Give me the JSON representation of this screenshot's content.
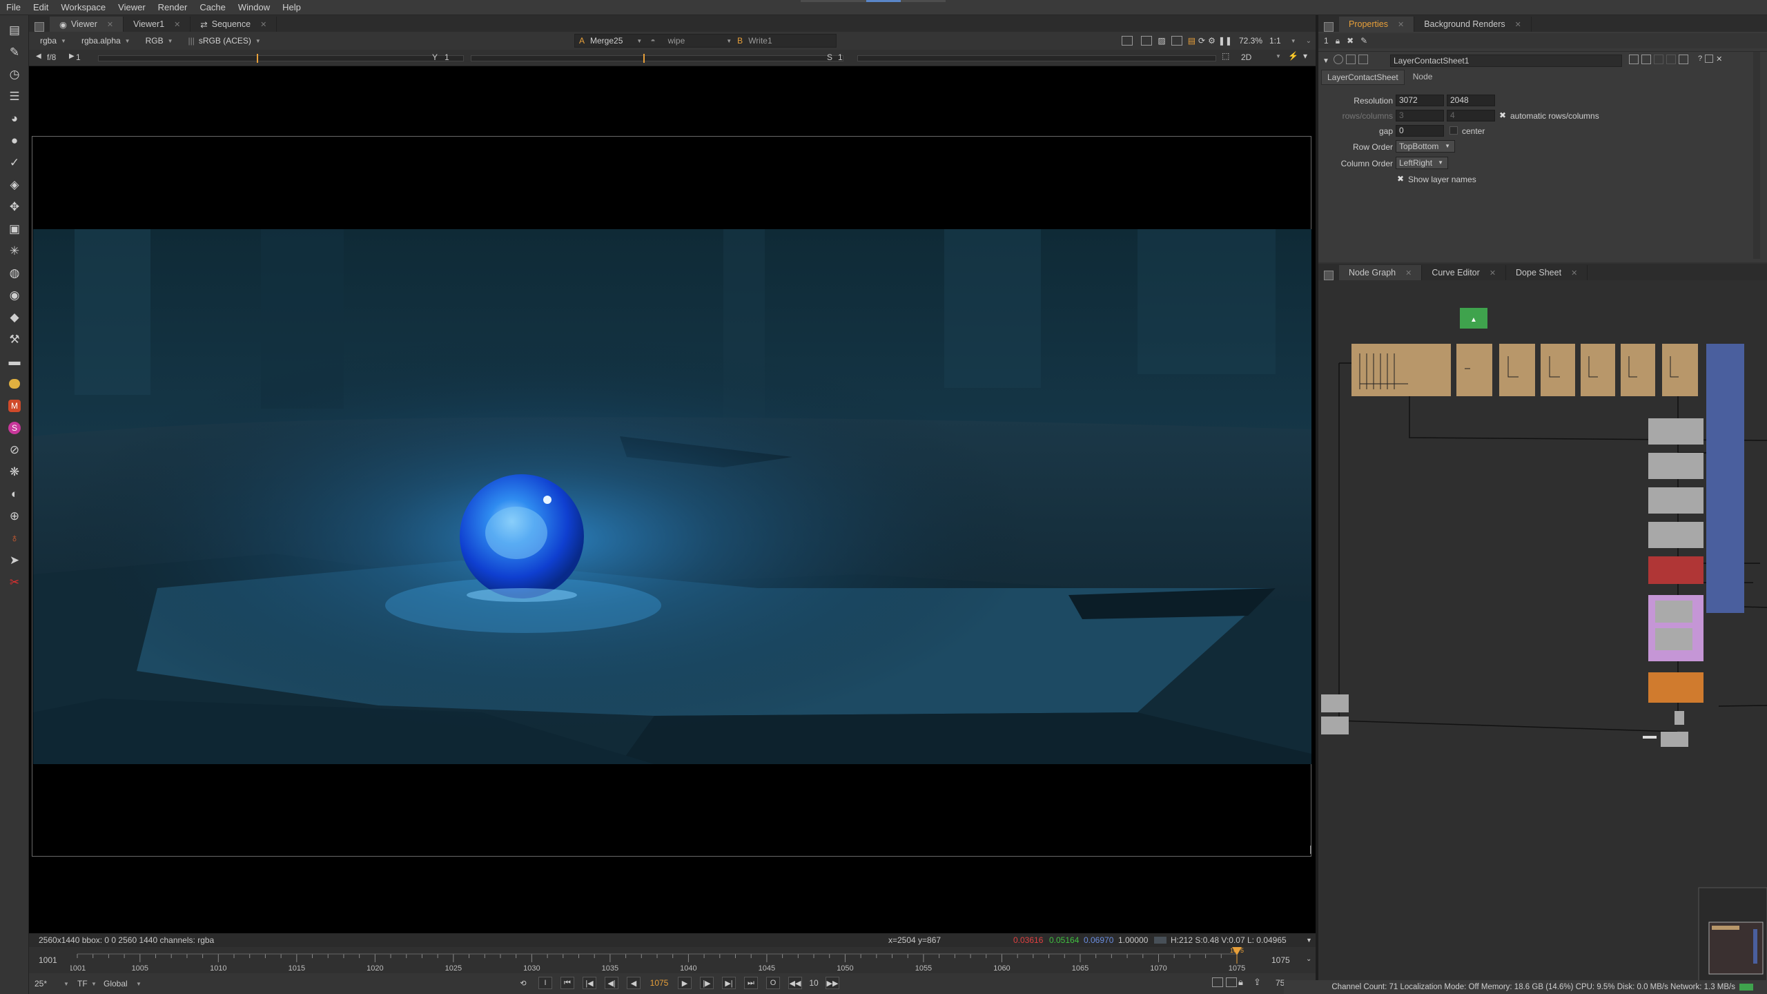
{
  "menu": [
    "File",
    "Edit",
    "Workspace",
    "Viewer",
    "Render",
    "Cache",
    "Window",
    "Help"
  ],
  "viewer_tabs": [
    {
      "label": "Viewer"
    },
    {
      "label": "Viewer1"
    },
    {
      "label": "Sequence"
    }
  ],
  "viewer_controls": {
    "layer": "rgba",
    "channel": "rgba.alpha",
    "colorspace": "RGB",
    "display": "sRGB (ACES)",
    "input_a_label": "A",
    "input_a": "Merge25",
    "wipe": "wipe",
    "input_b_label": "B",
    "input_b": "Write1",
    "zoom": "72.3%",
    "ratio": "1:1"
  },
  "viewer_controls2": {
    "fstop": "f/8",
    "fstop_value": "1",
    "y_label": "Y",
    "y_value": "1",
    "s_label": "S",
    "s_value": "1",
    "view_mode": "2D"
  },
  "info": {
    "format": "2560x1440  bbox: 0 0 2560 1440 channels: rgba",
    "coords": "x=2504 y=867",
    "r": "0.03616",
    "g": "0.05164",
    "b": "0.06970",
    "a": "1.00000",
    "hsv": "H:212 S:0.48 V:0.07  L: 0.04965"
  },
  "timeline": {
    "start": "1001",
    "end": "1075",
    "current": "1075",
    "ticks": [
      "1001",
      "1005",
      "1010",
      "1015",
      "1020",
      "1025",
      "1030",
      "1035",
      "1040",
      "1045",
      "1050",
      "1055",
      "1060",
      "1065",
      "1070",
      "1075"
    ],
    "fps": "25*",
    "tf": "TF",
    "range": "Global",
    "increment": "10",
    "frame_display": "1075",
    "end_field": "75"
  },
  "properties": {
    "tabs": [
      {
        "label": "Properties"
      },
      {
        "label": "Background Renders"
      }
    ],
    "max_panels": "1",
    "node_name": "LayerContactSheet1",
    "subtabs": [
      "LayerContactSheet",
      "Node"
    ],
    "resolution_label": "Resolution",
    "res_w": "3072",
    "res_h": "2048",
    "rows_label": "rows/columns",
    "rows": "3",
    "columns": "4",
    "auto_label": "automatic rows/columns",
    "gap_label": "gap",
    "gap": "0",
    "center_label": "center",
    "row_order_label": "Row Order",
    "row_order": "TopBottom",
    "col_order_label": "Column Order",
    "col_order": "LeftRight",
    "show_names_label": "Show layer names"
  },
  "graph_tabs": [
    {
      "label": "Node Graph"
    },
    {
      "label": "Curve Editor"
    },
    {
      "label": "Dope Sheet"
    }
  ],
  "status": "Channel Count: 71  Localization Mode: Off  Memory: 18.6 GB (14.6%)  CPU: 9.5%  Disk: 0.0 MB/s  Network: 1.3 MB/s",
  "colors": {
    "accent": "#e8a03a",
    "node_tan": "#b8976a",
    "node_grey": "#a8a8a8",
    "node_red": "#b03636",
    "node_purple": "#c596d6",
    "node_orange": "#d07b2e",
    "node_green": "#3fa34d",
    "backdrop_blue": "#4a5f9e"
  }
}
